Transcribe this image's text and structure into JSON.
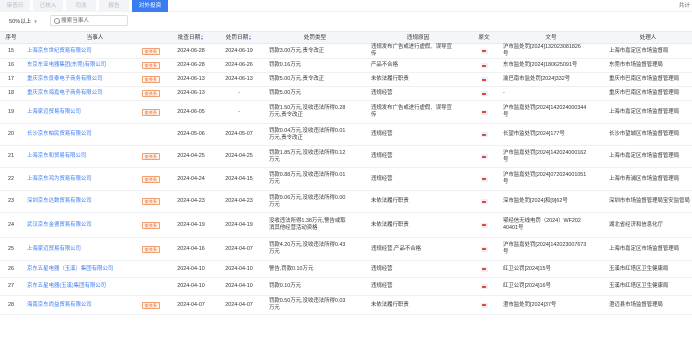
{
  "tabs": [
    {
      "label": "审查日",
      "active": false
    },
    {
      "label": "已核入",
      "active": false
    },
    {
      "label": "司法",
      "active": false
    },
    {
      "label": "报告",
      "active": false
    },
    {
      "label": "对外投资",
      "active": true
    }
  ],
  "total_label": "共计",
  "filter": {
    "select_value": "50%以上",
    "search_placeholder": "搜索当事人"
  },
  "columns": {
    "seq": "序号",
    "party": "当事人",
    "decision_date": "批查日期",
    "publish_date": "处罚日期",
    "penalty_type": "处罚类型",
    "reason": "违规原因",
    "source": "原文",
    "doc_no": "文号",
    "authority": "处理人"
  },
  "badge_icon": "shareholding-tag",
  "pdf_icon": "pdf-icon",
  "rows": [
    {
      "seq": "15",
      "party": "上海京东世纪贸易有限公司",
      "tag": "查关系",
      "decision_date": "2024-06-28",
      "publish_date": "2024-06-19",
      "penalty_type": [
        "罚款3.00万元,责令改正"
      ],
      "reason": [
        "违规发布广告或进行虚假、误导宣",
        "传"
      ],
      "doc_no": [
        "沪市监处罚[2024]132023081826",
        "号"
      ],
      "authority": "上海市嘉定区市场监督局"
    },
    {
      "seq": "16",
      "party": "东京东亚电器集团(东莞)有限公司",
      "tag": "查关系",
      "decision_date": "2024-06-28",
      "publish_date": "2024-06-26",
      "penalty_type": [
        "罚款0.16万元"
      ],
      "reason": [
        "产品不合格"
      ],
      "doc_no": [
        "东市监处罚[2024]180625091号"
      ],
      "authority": "东莞市市场监督管理局"
    },
    {
      "seq": "17",
      "party": "重庆京东景泰电子商务有限公司",
      "tag": "查关系",
      "decision_date": "2024-06-13",
      "publish_date": "2024-06-13",
      "penalty_type": [
        "罚款5.00万元,责令改正"
      ],
      "reason": [
        "未依法履行职责"
      ],
      "doc_no": [
        "渝巴南市监处罚[2024]332号"
      ],
      "authority": "重庆市巴南区市场监督管理局"
    },
    {
      "seq": "18",
      "party": "重庆京东海嘉电子商务有限公司",
      "tag": "查关系",
      "decision_date": "2024-06-13",
      "publish_date": "-",
      "penalty_type": [
        "罚款5.00万元"
      ],
      "reason": [
        "违规经营"
      ],
      "doc_no": [
        "-"
      ],
      "authority": "重庆市巴南区市场监督管理局"
    },
    {
      "seq": "19",
      "party": "上海家迈贸易有限公司",
      "tag": "查关系",
      "decision_date": "2024-06-05",
      "publish_date": "-",
      "penalty_type": [
        "罚款1.50万元,没收违法所得0.28",
        "万元,责令改正"
      ],
      "reason": [
        "违规发布广告或进行虚假、误导宣",
        "传"
      ],
      "doc_no": [
        "沪市监嘉处罚[2024]142024000344",
        "号"
      ],
      "authority": "上海市嘉定区市场监督管理局"
    },
    {
      "seq": "20",
      "party": "长沙京东帕民贸易有限公司",
      "tag": "",
      "decision_date": "2024-05-06",
      "publish_date": "2024-05-07",
      "penalty_type": [
        "罚款0.04万元,没收违法所得0.01",
        "万元,责令改正"
      ],
      "reason": [
        "违规经营"
      ],
      "doc_no": [
        "长望市监处罚[2024]177号"
      ],
      "authority": "长沙市望城区市场监督管理局"
    },
    {
      "seq": "21",
      "party": "上海京东和贸易有限公司",
      "tag": "查关系",
      "decision_date": "2024-04-25",
      "publish_date": "2024-04-25",
      "penalty_type": [
        "罚款1.85万元,没收违法所得0.12",
        "万元"
      ],
      "reason": [
        "违规经营"
      ],
      "doc_no": [
        "沪市监嘉处罚[2024]142024000162",
        "号"
      ],
      "authority": "上海市嘉定区市场监督管理局"
    },
    {
      "seq": "22",
      "party": "上海京东鸿为贸易有限公司",
      "tag": "查关系",
      "decision_date": "2024-04-24",
      "publish_date": "2024-04-15",
      "penalty_type": [
        "罚款0.88万元,没收违法所得0.01",
        "万元"
      ],
      "reason": [
        "违规经营"
      ],
      "doc_no": [
        "沪市监嘉处罚[2024]072024001051",
        "号"
      ],
      "authority": "上海市青浦区市场监督管理局"
    },
    {
      "seq": "23",
      "party": "深圳京东达数贸易有限公司",
      "tag": "查关系",
      "decision_date": "2024-04-23",
      "publish_date": "2024-04-23",
      "penalty_type": [
        "罚款9.06万元,没收违法所得0.00",
        "万元"
      ],
      "reason": [
        "未依法履行职责"
      ],
      "doc_no": [
        "深市监处罚[2024]和[9]62号"
      ],
      "authority": "深圳市市场监督管理局宝安监管局"
    },
    {
      "seq": "24",
      "party": "武汉京东金德贸易有限公司",
      "tag": "查关系",
      "decision_date": "2024-04-19",
      "publish_date": "2024-04-19",
      "penalty_type": [
        "没收违法所得1.38万元,警告或取",
        "消其他经营活动资格"
      ],
      "reason": [
        "未依法履行职责"
      ],
      "doc_no": [
        "鄂经信无线电罚（2024）WF202",
        "40401号"
      ],
      "authority": "湖北省经济和信息化厅"
    },
    {
      "seq": "25",
      "party": "上海家迈贸易有限公司",
      "tag": "查关系",
      "decision_date": "2024-04-16",
      "publish_date": "2024-04-07",
      "penalty_type": [
        "罚款4.20万元,没收违法所得0.43",
        "万元"
      ],
      "reason": [
        "违规经营,产品不合格"
      ],
      "doc_no": [
        "沪市监嘉处罚[2024]142023007673",
        "号"
      ],
      "authority": "上海市嘉定区市场监督管理局"
    },
    {
      "seq": "26",
      "party": "京东五星电器（玉溪）集团有限公司",
      "tag": "",
      "decision_date": "2024-04-10",
      "publish_date": "2024-04-10",
      "penalty_type": [
        "警告,罚款0.10万元"
      ],
      "reason": [
        "违规经营"
      ],
      "doc_no": [
        "红卫公罚[2024]15号"
      ],
      "authority": "玉溪市红塔区卫生健康局"
    },
    {
      "seq": "27",
      "party": "京东五星电器(玉溪)集团有限公司",
      "tag": "",
      "decision_date": "2024-04-10",
      "publish_date": "2024-04-10",
      "penalty_type": [
        "罚款0.10万元"
      ],
      "reason": [
        "违规经营"
      ],
      "doc_no": [
        "红卫公罚[2024]16号"
      ],
      "authority": "玉溪市红塔区卫生健康局"
    },
    {
      "seq": "28",
      "party": "海南京东尚益贸易有限公司",
      "tag": "查关系",
      "decision_date": "2024-04-07",
      "publish_date": "2024-04-07",
      "penalty_type": [
        "罚款0.50万元,没收违法所得0.03",
        "万元"
      ],
      "reason": [
        "未依法履行职责"
      ],
      "doc_no": [
        "澄市监处罚[2024]37号"
      ],
      "authority": "澄迈县市场监督管理局"
    }
  ]
}
